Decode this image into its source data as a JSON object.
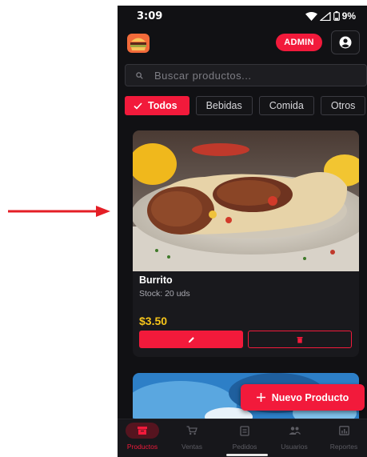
{
  "status_bar": {
    "time": "3:09",
    "battery": "9%"
  },
  "header": {
    "badge_label": "ADMIN"
  },
  "search": {
    "placeholder": "Buscar productos..."
  },
  "filters": [
    {
      "label": "Todos",
      "active": true
    },
    {
      "label": "Bebidas",
      "active": false
    },
    {
      "label": "Comida",
      "active": false
    },
    {
      "label": "Otros",
      "active": false
    }
  ],
  "product": {
    "name": "Burrito",
    "stock": "Stock: 20 uds",
    "price": "$3.50"
  },
  "fab": {
    "label": "Nuevo Producto"
  },
  "nav": [
    {
      "label": "Productos",
      "icon": "box-icon",
      "active": true
    },
    {
      "label": "Ventas",
      "icon": "cart-icon",
      "active": false
    },
    {
      "label": "Pedidos",
      "icon": "clipboard-icon",
      "active": false
    },
    {
      "label": "Usuarios",
      "icon": "users-icon",
      "active": false
    },
    {
      "label": "Reportes",
      "icon": "chart-icon",
      "active": false
    }
  ],
  "colors": {
    "accent": "#f21a3b",
    "price": "#f7c51a",
    "background": "#111114",
    "card": "#19191d"
  }
}
